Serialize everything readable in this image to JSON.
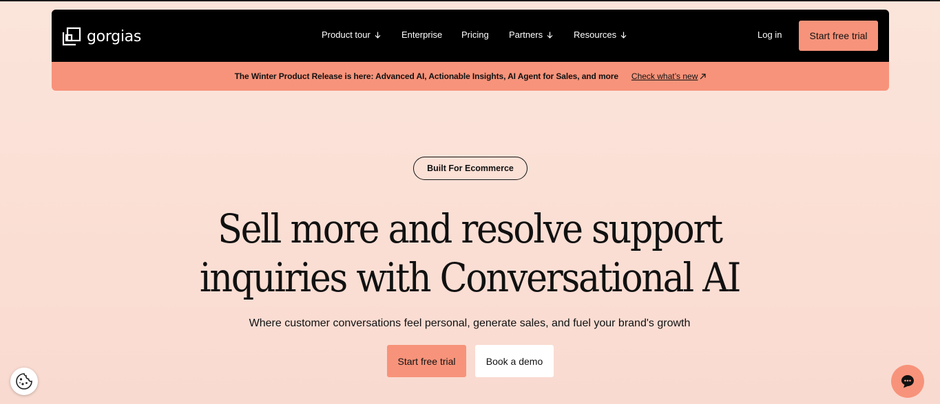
{
  "brand": {
    "name": "gorgias",
    "logo_icon": "gorgias-logo-icon"
  },
  "nav": {
    "items": [
      {
        "label": "Product tour",
        "has_dropdown": true
      },
      {
        "label": "Enterprise",
        "has_dropdown": false
      },
      {
        "label": "Pricing",
        "has_dropdown": false
      },
      {
        "label": "Partners",
        "has_dropdown": true
      },
      {
        "label": "Resources",
        "has_dropdown": true
      }
    ],
    "login_label": "Log in",
    "cta_label": "Start free trial"
  },
  "banner": {
    "text": "The Winter Product Release is here: Advanced AI, Actionable Insights, AI Agent for Sales, and more",
    "link_label": "Check what’s new",
    "link_icon": "arrow-up-right-icon"
  },
  "hero": {
    "badge": "Built For Ecommerce",
    "headline_line1": "Sell more and resolve support",
    "headline_line2": "inquiries with Conversational AI",
    "subheadline": "Where customer conversations feel personal, generate sales, and fuel your brand's growth",
    "primary_cta": "Start free trial",
    "secondary_cta": "Book a demo"
  },
  "floating": {
    "cookie_icon": "cookie-icon",
    "chat_icon": "chat-bubble-icon"
  },
  "colors": {
    "accent": "#f7937a",
    "background": "#fbe2d8",
    "navbar": "#000000",
    "text": "#111111"
  }
}
